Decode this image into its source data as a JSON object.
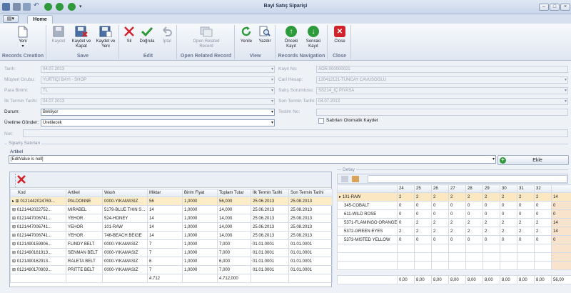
{
  "window": {
    "title": "Bayi Satış Siparişi"
  },
  "tabs": {
    "app_menu": "▤▾",
    "home": "Home"
  },
  "ribbon": {
    "groups": {
      "records_creation": "Records Creation",
      "save": "Save",
      "edit": "Edit",
      "open_related": "Open Related Record",
      "view": "View",
      "records_navigation": "Records Navigation",
      "close": "Close"
    },
    "buttons": {
      "new": "Yeni",
      "save": "Kaydet",
      "save_close": "Kaydet ve Kapat",
      "save_new": "Kaydet ve Yeni",
      "delete": "Sil",
      "validate": "Doğrula",
      "cancel": "İptal",
      "open_related": "Open Related Record",
      "refresh": "Yenile",
      "print": "Yazdır",
      "previous": "Önceki Kayıt",
      "next": "Sonraki Kayıt",
      "close": "Close"
    }
  },
  "form": {
    "tarih_label": "Tarih:",
    "tarih": "04.07.2013",
    "musteri_grubu_label": "Müşteri Grubu:",
    "musteri_grubu": "YURTİÇİ BAYİ - SHOP",
    "para_birimi_label": "Para Birimi:",
    "para_birimi": "TL",
    "ilk_termin_label": "İlk Termin Tarihi:",
    "ilk_termin": "04.07.2013",
    "durum_label": "Durum:",
    "durum": "Bekliyor",
    "uretime_gonder_label": "Üretime Gönder:",
    "uretime_gonder": "Üretilecek",
    "not_label": "Not:",
    "kayit_no_label": "Kayıt No:",
    "kayit_no": "AOR.000000021",
    "cari_hesap_label": "Cari Hesap:",
    "cari_hesap": "120412121-TUNCAY CAVUSOGLU",
    "satis_sorumlusu_label": "Satış Sorumlusu:",
    "satis_sorumlusu": "SS214_İÇ PİYASA",
    "son_termin_label": "Son Termin Tarihi:",
    "son_termin": "04.07.2013",
    "teslim_no_label": "Teslim No:",
    "auto_save_label": "Sabrları Otomatik Kaydet"
  },
  "section": {
    "title": "Sipariş Satırları",
    "artikel_label": "Artikel",
    "artikel_value": "[EditValue is null]",
    "ekle": "Ekle"
  },
  "lines": {
    "columns": [
      "Kod",
      "Artikel",
      "Wash",
      "Miktar",
      "Birim Fiyat",
      "Toplam Tutar",
      "İlk Termin Tarihi",
      "Son Termin Tarihi"
    ],
    "rows": [
      [
        "0121442024763...",
        "PALDONNE",
        "0000-YIKAMASIZ",
        "56",
        "1,0000",
        "56,000",
        "25.06.2013",
        "25.08.2013"
      ],
      [
        "0121442022752...",
        "MIRABEL",
        "5179-BLUE THIN S...",
        "14",
        "1,0000",
        "14,000",
        "25.06.2013",
        "25.08.2013"
      ],
      [
        "0121447006741...",
        "YEHOR",
        "524-HONEY",
        "14",
        "1,0000",
        "14,000",
        "25.06.2013",
        "25.08.2013"
      ],
      [
        "0121447006741...",
        "YEHOR",
        "101-RAW",
        "14",
        "1,0000",
        "14,000",
        "25.06.2013",
        "25.08.2013"
      ],
      [
        "0121447006741...",
        "YEHOR",
        "746-BEACH BEIGE",
        "14",
        "1,0000",
        "14,000",
        "25.06.2013",
        "25.08.2013"
      ],
      [
        "0121490159906...",
        "FLINDY BELT",
        "0000-YIKAMASIZ",
        "7",
        "1,0000",
        "7,000",
        "01.01.0001",
        "01.01.0001"
      ],
      [
        "0121490161913...",
        "SENMAN BELT",
        "0000-YIKAMASIZ",
        "7",
        "1,0000",
        "7,000",
        "01.01.0001",
        "01.01.0001"
      ],
      [
        "0121490162913...",
        "RALETA BELT",
        "0000-YIKAMASIZ",
        "6",
        "1,0000",
        "6,000",
        "01.01.0001",
        "01.01.0001"
      ],
      [
        "0121490170903...",
        "PRITTE BELT",
        "0000-YIKAMASIZ",
        "7",
        "1,0000",
        "7,000",
        "01.01.0001",
        "01.01.0001"
      ]
    ],
    "totals": {
      "miktar": "4.712",
      "toplam": "4.712,000"
    }
  },
  "detail": {
    "title": "Detay",
    "columns": [
      "24",
      "25",
      "26",
      "27",
      "28",
      "29",
      "30",
      "31",
      "32",
      ""
    ],
    "rows": [
      {
        "name": "101-RAW",
        "values": [
          "2",
          "2",
          "2",
          "2",
          "2",
          "2",
          "2",
          "2",
          "2",
          "14"
        ]
      },
      {
        "name": "345-COBALT",
        "values": [
          "0",
          "0",
          "0",
          "0",
          "0",
          "0",
          "0",
          "0",
          "0",
          "0"
        ]
      },
      {
        "name": "611-WILD ROSE",
        "values": [
          "0",
          "0",
          "0",
          "0",
          "0",
          "0",
          "0",
          "0",
          "0",
          "0"
        ]
      },
      {
        "name": "5371-FLAMINGO ORANGE",
        "values": [
          "0",
          "2",
          "2",
          "2",
          "2",
          "2",
          "2",
          "2",
          "2",
          "14"
        ]
      },
      {
        "name": "5372-GREEN EYES",
        "values": [
          "2",
          "2",
          "2",
          "2",
          "2",
          "2",
          "2",
          "2",
          "2",
          "14"
        ]
      },
      {
        "name": "5373-MISTED YELLOW",
        "values": [
          "0",
          "0",
          "0",
          "0",
          "0",
          "0",
          "0",
          "0",
          "0",
          "0"
        ]
      }
    ],
    "totals": [
      "0,00",
      "8,00",
      "8,00",
      "8,00",
      "8,00",
      "8,00",
      "8,00",
      "8,00",
      "8,00",
      "56,00"
    ]
  }
}
